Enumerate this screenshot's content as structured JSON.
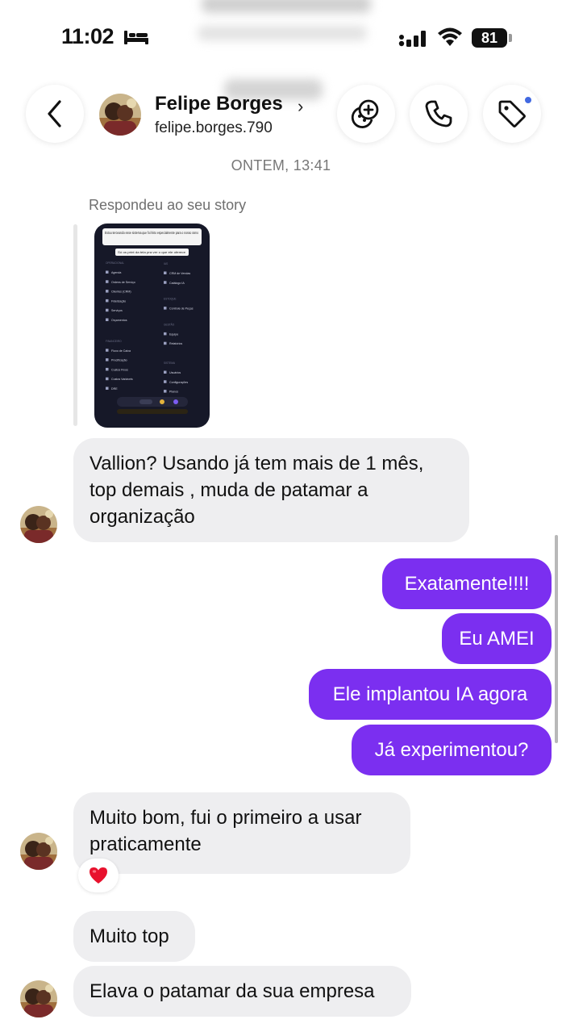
{
  "status_bar": {
    "time": "11:02",
    "battery": "81"
  },
  "header": {
    "contact_name": "Felipe Borges",
    "username": "felipe.borges.790",
    "chevron": "›",
    "icons": [
      "back-chevron-icon",
      "effects-icon",
      "phone-icon",
      "tag-icon"
    ],
    "notification_dot_color": "#4169e1"
  },
  "conversation": {
    "timestamp": "ONTEM, 13:41",
    "story_caption": "Respondeu ao seu story",
    "story_preview": {
      "headline": "Estou terceando esse sistema que foi feito especialmente para o nosso ramo",
      "subline": "Só os print da tela pra ver o que ele oferece",
      "left_sections": [
        {
          "title": "OPERACIONAL",
          "items": [
            "Agenda",
            "Ordens de Serviço",
            "Clientes (CRM)",
            "Fidelização",
            "Serviços",
            "Orçamentos"
          ]
        },
        {
          "title": "FINANCEIRO",
          "items": [
            "Fluxo de Caixa",
            "Precificação",
            "Custos Fixos",
            "Custos Variáveis",
            "DRE"
          ]
        }
      ],
      "right_sections": [
        {
          "title": "IAS",
          "items": [
            "CRM de Vendas",
            "Catálogo IA"
          ]
        },
        {
          "title": "ESTOQUE",
          "items": [
            "Controle de Peças"
          ]
        },
        {
          "title": "GESTÃO",
          "items": [
            "Equipe",
            "Relatórios"
          ]
        },
        {
          "title": "SISTEMA",
          "items": [
            "Usuários",
            "Configurações",
            "Planos"
          ]
        }
      ]
    },
    "messages": [
      {
        "direction": "in",
        "text": "Vallion? Usando já tem mais de 1 mês, top demais , muda de patamar a organização"
      },
      {
        "direction": "out",
        "text": "Exatamente!!!!"
      },
      {
        "direction": "out",
        "text": "Eu AMEI"
      },
      {
        "direction": "out",
        "text": "Ele implantou IA agora"
      },
      {
        "direction": "out",
        "text": "Já experimentou?"
      },
      {
        "direction": "in",
        "text": "Muito bom, fui o primeiro a usar praticamente",
        "reaction": "heart-emoji"
      },
      {
        "direction": "in",
        "text": "Muito top"
      },
      {
        "direction": "in",
        "text": "Elava o patamar da sua empresa"
      }
    ]
  },
  "colors": {
    "outgoing_bubble": "#7b2ff0",
    "incoming_bubble": "#eeeef0",
    "reaction_heart": "#e8112d"
  }
}
